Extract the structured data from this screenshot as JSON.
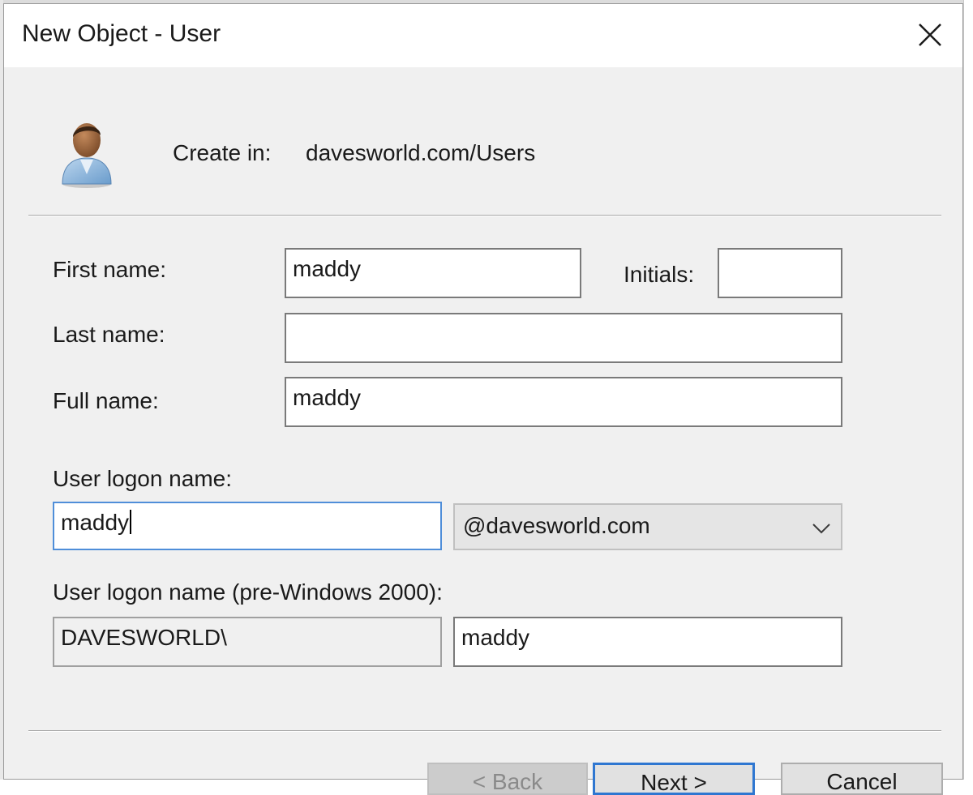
{
  "dialog": {
    "title": "New Object - User"
  },
  "header": {
    "create_in_label": "Create in:",
    "create_in_value": "davesworld.com/Users"
  },
  "form": {
    "first_name_label": "First name:",
    "first_name_value": "maddy",
    "initials_label": "Initials:",
    "initials_value": "",
    "last_name_label": "Last name:",
    "last_name_value": "",
    "full_name_label": "Full name:",
    "full_name_value": "maddy",
    "logon_name_label": "User logon name:",
    "logon_name_value": "maddy",
    "domain_suffix_selected": "@davesworld.com",
    "pre2000_label": "User logon name (pre-Windows 2000):",
    "pre2000_domain": "DAVESWORLD\\",
    "pre2000_value": "maddy"
  },
  "buttons": {
    "back_label": "< Back",
    "next_label": "Next >",
    "cancel_label": "Cancel"
  },
  "icons": {
    "close": "close-icon",
    "user": "user-icon",
    "dropdown": "chevron-down-icon"
  },
  "colors": {
    "focus_border": "#4f8ed9",
    "default_button_border": "#2f77d1",
    "dialog_background": "#f0f0f0"
  }
}
